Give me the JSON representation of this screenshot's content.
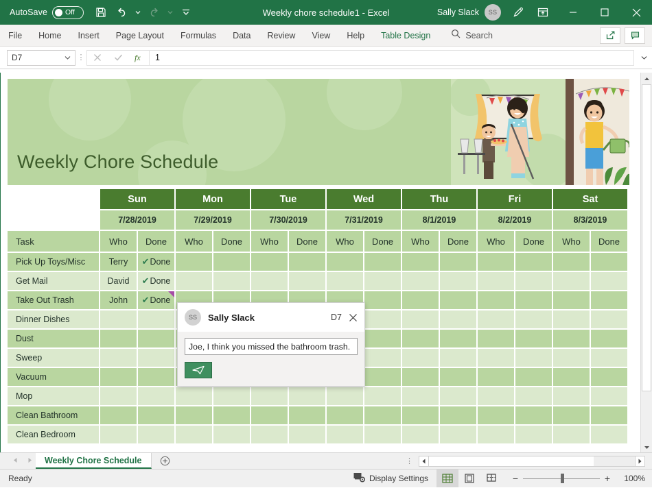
{
  "titlebar": {
    "autosave_label": "AutoSave",
    "autosave_state": "Off",
    "save_icon": "save-icon",
    "undo_icon": "undo-icon",
    "redo_icon": "redo-icon",
    "customize_icon": "customize-quick-access-icon",
    "document_title": "Weekly chore schedule1  -  Excel",
    "user_name": "Sally Slack",
    "user_initials": "SS",
    "pen_icon": "ink-pen-icon",
    "ribbon_display_icon": "ribbon-display-options-icon",
    "minimize": "—",
    "maximize": "☐",
    "close": "✕"
  },
  "ribbon": {
    "tabs": [
      {
        "label": "File",
        "contextual": false
      },
      {
        "label": "Home",
        "contextual": false
      },
      {
        "label": "Insert",
        "contextual": false
      },
      {
        "label": "Page Layout",
        "contextual": false
      },
      {
        "label": "Formulas",
        "contextual": false
      },
      {
        "label": "Data",
        "contextual": false
      },
      {
        "label": "Review",
        "contextual": false
      },
      {
        "label": "View",
        "contextual": false
      },
      {
        "label": "Help",
        "contextual": false
      },
      {
        "label": "Table Design",
        "contextual": true
      }
    ],
    "search_placeholder": "Search",
    "share_icon": "share-icon",
    "comments_icon": "comments-icon"
  },
  "formula_bar": {
    "name_box_value": "D7",
    "cancel_icon": "cancel-icon",
    "enter_icon": "enter-icon",
    "function_icon": "insert-function-icon",
    "formula_value": "1"
  },
  "banner": {
    "title": "Weekly Chore Schedule",
    "bg_color": "#b9d6a0",
    "title_color": "#3d5c2b",
    "illustration": "family-doing-chores-illustration"
  },
  "table": {
    "days": [
      "Sun",
      "Mon",
      "Tue",
      "Wed",
      "Thu",
      "Fri",
      "Sat"
    ],
    "dates": [
      "7/28/2019",
      "7/29/2019",
      "7/30/2019",
      "7/31/2019",
      "8/1/2019",
      "8/2/2019",
      "8/3/2019"
    ],
    "task_header": "Task",
    "who_header": "Who",
    "done_header": "Done",
    "done_value": "Done",
    "check_glyph": "✔",
    "header_color": "#4a7c2f",
    "band_dark": "#b9d6a0",
    "band_light": "#dbe9cd",
    "comment_flag_color": "#a64ca6",
    "rows": [
      {
        "task": "Pick Up Toys/Misc",
        "who": "Terry",
        "done": true,
        "flag": false
      },
      {
        "task": "Get Mail",
        "who": "David",
        "done": true,
        "flag": false
      },
      {
        "task": "Take Out Trash",
        "who": "John",
        "done": true,
        "flag": true
      },
      {
        "task": "Dinner Dishes",
        "who": "",
        "done": false,
        "flag": false
      },
      {
        "task": "Dust",
        "who": "",
        "done": false,
        "flag": false
      },
      {
        "task": "Sweep",
        "who": "",
        "done": false,
        "flag": false
      },
      {
        "task": "Vacuum",
        "who": "",
        "done": false,
        "flag": false
      },
      {
        "task": "Mop",
        "who": "",
        "done": false,
        "flag": false
      },
      {
        "task": "Clean Bathroom",
        "who": "",
        "done": false,
        "flag": false
      },
      {
        "task": "Clean Bedroom",
        "who": "",
        "done": false,
        "flag": false
      }
    ]
  },
  "comment": {
    "author": "Sally Slack",
    "initials": "SS",
    "cell_ref": "D7",
    "close_icon": "close-icon",
    "text_value": "Joe, I think you missed the bathroom trash.",
    "send_icon": "send-icon"
  },
  "sheet_tabs": {
    "prev_icon": "previous-sheet-icon",
    "next_icon": "next-sheet-icon",
    "active_tab": "Weekly Chore Schedule",
    "add_sheet_icon": "add-sheet-icon"
  },
  "status_bar": {
    "status_text": "Ready",
    "display_settings_label": "Display Settings",
    "display_settings_icon": "display-settings-icon",
    "view_normal_icon": "normal-view-icon",
    "view_page_layout_icon": "page-layout-view-icon",
    "view_page_break_icon": "page-break-preview-icon",
    "zoom_out": "−",
    "zoom_in": "+",
    "zoom_level": "100%"
  }
}
